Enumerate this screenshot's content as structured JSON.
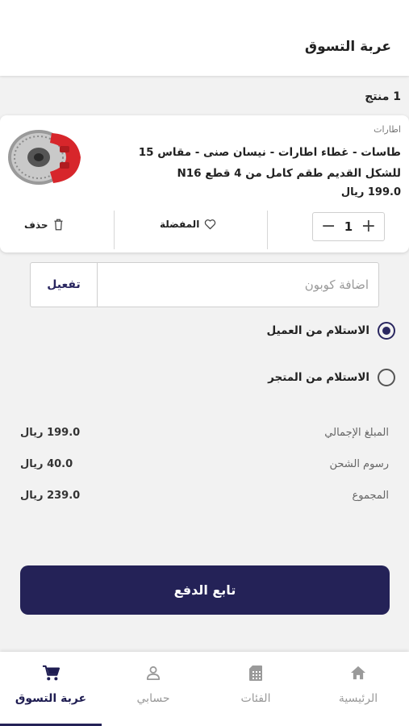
{
  "header": {
    "title": "عربة التسوق"
  },
  "cart": {
    "count_label": "1 منتج",
    "items": [
      {
        "category": "اطارات",
        "name": "طاسات - غطاء اطارات - نيسان صنى - مقاس 15 للشكل القديم طقم كامل من 4 قطع N16",
        "price": "199.0 ريال",
        "quantity": "1",
        "favorite_label": "المفضلة",
        "delete_label": "حذف"
      }
    ]
  },
  "coupon": {
    "placeholder": "اضافة كوبون",
    "activate_label": "تفعيل"
  },
  "delivery": {
    "options": [
      {
        "label": "الاستلام من العميل",
        "selected": true
      },
      {
        "label": "الاستلام من المتجر",
        "selected": false
      }
    ]
  },
  "summary": {
    "rows": [
      {
        "label": "المبلغ الإجمالي",
        "value": "199.0 ريال"
      },
      {
        "label": "رسوم الشحن",
        "value": "40.0 ريال"
      },
      {
        "label": "المجموع",
        "value": "239.0 ريال"
      }
    ]
  },
  "checkout": {
    "label": "تابع الدفع"
  },
  "bottom_nav": {
    "items": [
      {
        "label": "الرئيسية",
        "icon": "home-icon"
      },
      {
        "label": "الفئات",
        "icon": "categories-icon"
      },
      {
        "label": "حسابي",
        "icon": "account-icon"
      },
      {
        "label": "عربة التسوق",
        "icon": "cart-icon",
        "active": true
      }
    ]
  },
  "colors": {
    "primary": "#242257",
    "background": "#f2f2f2",
    "caliper_red": "#d7262b"
  }
}
